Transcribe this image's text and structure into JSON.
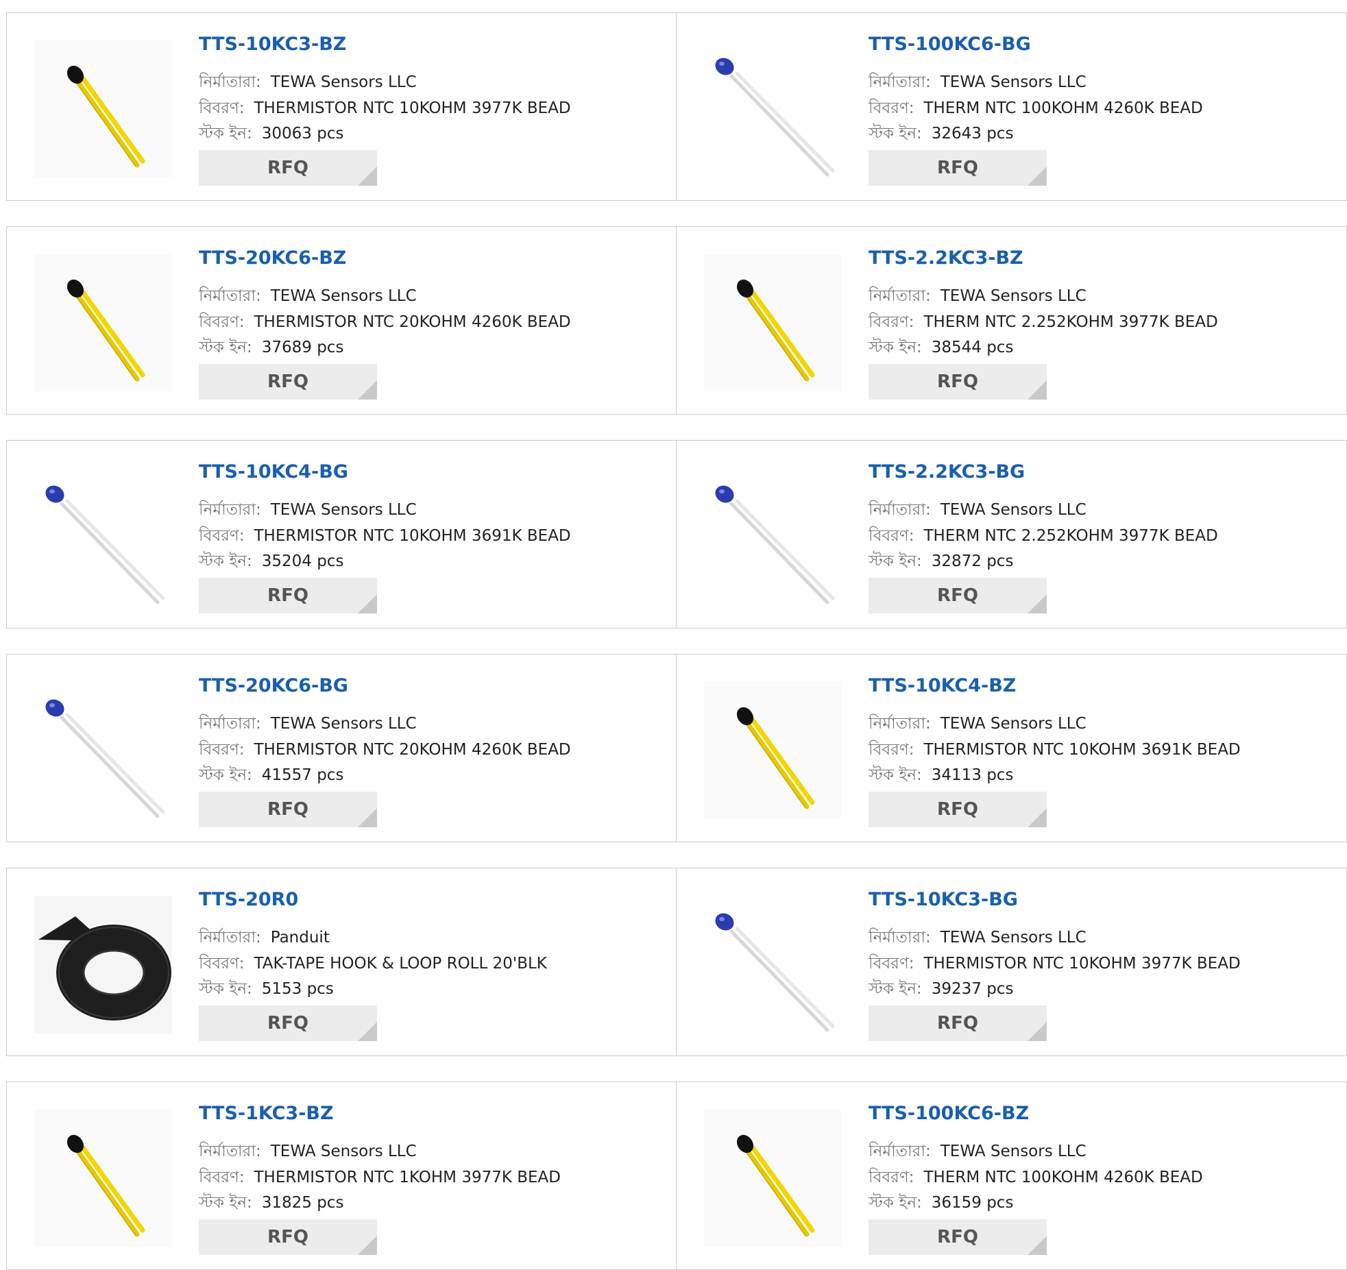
{
  "labels": {
    "manufacturer": "নির্মাতারা:",
    "description": "বিবরণ:",
    "stock": "স্টক ইন:",
    "rfq": "RFQ"
  },
  "products": [
    {
      "part": "TTS-10KC3-BZ",
      "manufacturer": "TEWA Sensors LLC",
      "description": "THERMISTOR NTC 10KOHM 3977K BEAD",
      "stock": "30063 pcs",
      "image": "thermistor-yellow-leads"
    },
    {
      "part": "TTS-100KC6-BG",
      "manufacturer": "TEWA Sensors LLC",
      "description": "THERM NTC 100KOHM 4260K BEAD",
      "stock": "32643 pcs",
      "image": "thermistor-blue-glass"
    },
    {
      "part": "TTS-20KC6-BZ",
      "manufacturer": "TEWA Sensors LLC",
      "description": "THERMISTOR NTC 20KOHM 4260K BEAD",
      "stock": "37689 pcs",
      "image": "thermistor-yellow-leads"
    },
    {
      "part": "TTS-2.2KC3-BZ",
      "manufacturer": "TEWA Sensors LLC",
      "description": "THERM NTC 2.252KOHM 3977K BEAD",
      "stock": "38544 pcs",
      "image": "thermistor-yellow-leads"
    },
    {
      "part": "TTS-10KC4-BG",
      "manufacturer": "TEWA Sensors LLC",
      "description": "THERMISTOR NTC 10KOHM 3691K BEAD",
      "stock": "35204 pcs",
      "image": "thermistor-blue-glass"
    },
    {
      "part": "TTS-2.2KC3-BG",
      "manufacturer": "TEWA Sensors LLC",
      "description": "THERM NTC 2.252KOHM 3977K BEAD",
      "stock": "32872 pcs",
      "image": "thermistor-blue-glass"
    },
    {
      "part": "TTS-20KC6-BG",
      "manufacturer": "TEWA Sensors LLC",
      "description": "THERMISTOR NTC 20KOHM 4260K BEAD",
      "stock": "41557 pcs",
      "image": "thermistor-blue-glass"
    },
    {
      "part": "TTS-10KC4-BZ",
      "manufacturer": "TEWA Sensors LLC",
      "description": "THERMISTOR NTC 10KOHM 3691K BEAD",
      "stock": "34113 pcs",
      "image": "thermistor-yellow-leads"
    },
    {
      "part": "TTS-20R0",
      "manufacturer": "Panduit",
      "description": "TAK-TAPE HOOK & LOOP ROLL 20'BLK",
      "stock": "5153 pcs",
      "image": "tape-roll-black"
    },
    {
      "part": "TTS-10KC3-BG",
      "manufacturer": "TEWA Sensors LLC",
      "description": "THERMISTOR NTC 10KOHM 3977K BEAD",
      "stock": "39237 pcs",
      "image": "thermistor-blue-glass"
    },
    {
      "part": "TTS-1KC3-BZ",
      "manufacturer": "TEWA Sensors LLC",
      "description": "THERMISTOR NTC 1KOHM 3977K BEAD",
      "stock": "31825 pcs",
      "image": "thermistor-yellow-leads"
    },
    {
      "part": "TTS-100KC6-BZ",
      "manufacturer": "TEWA Sensors LLC",
      "description": "THERM NTC 100KOHM 4260K BEAD",
      "stock": "36159 pcs",
      "image": "thermistor-yellow-leads"
    }
  ],
  "colors": {
    "part_link": "#1a5faf",
    "label_gray": "#777777",
    "rfq_bg": "#ececec",
    "border": "#cccccc"
  }
}
